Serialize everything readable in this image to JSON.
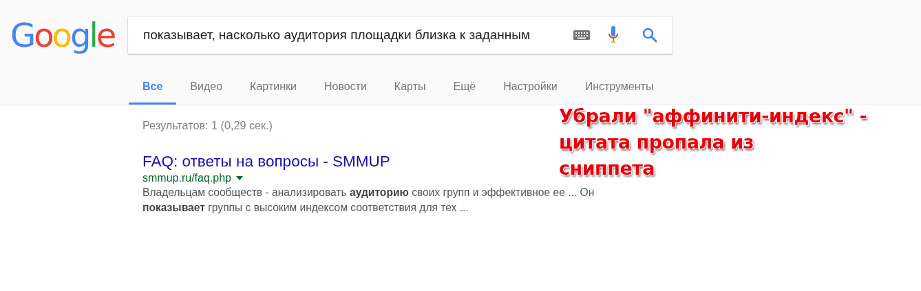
{
  "logo": [
    {
      "letter": "G",
      "color": "#4285f4"
    },
    {
      "letter": "o",
      "color": "#ea4335"
    },
    {
      "letter": "o",
      "color": "#fbbc05"
    },
    {
      "letter": "g",
      "color": "#4285f4"
    },
    {
      "letter": "l",
      "color": "#34a853"
    },
    {
      "letter": "e",
      "color": "#ea4335"
    }
  ],
  "search": {
    "value": "показывает, насколько аудитория площадки близка к заданным"
  },
  "tabs": [
    {
      "label": "Все",
      "selected": true
    },
    {
      "label": "Видео",
      "selected": false
    },
    {
      "label": "Картинки",
      "selected": false
    },
    {
      "label": "Новости",
      "selected": false
    },
    {
      "label": "Карты",
      "selected": false
    },
    {
      "label": "Ещё",
      "selected": false
    },
    {
      "label": "Настройки",
      "selected": false
    },
    {
      "label": "Инструменты",
      "selected": false
    }
  ],
  "result_stats": "Результатов: 1 (0,29 сек.)",
  "results": [
    {
      "title": "FAQ: ответы на вопросы - SMMUP",
      "url": "smmup.ru/faq.php",
      "snippet": "Владельцам сообществ - анализировать **аудиторию** своих групп и эффективное ее ... Он **показывает** группы с высоким индексом соответствия для тех ..."
    }
  ],
  "annotation": {
    "lines": [
      "Убрали \"аффинити-индекс\" -",
      "цитата пропала из",
      "сниппета"
    ]
  }
}
